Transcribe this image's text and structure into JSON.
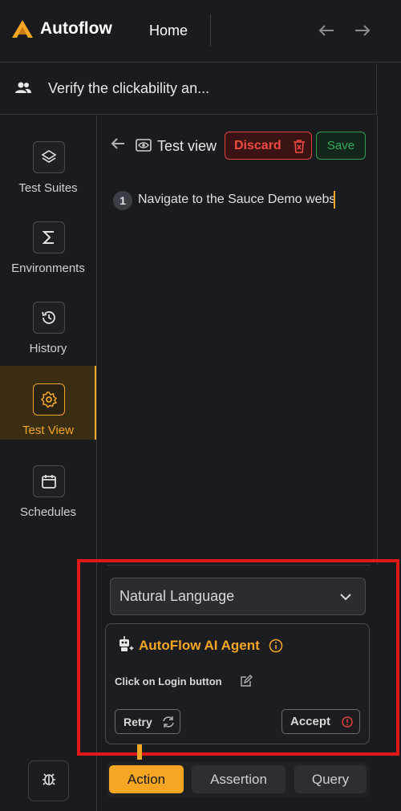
{
  "header": {
    "app_name": "Autoflow",
    "home_label": "Home",
    "back_icon": "arrow-left-icon",
    "forward_icon": "arrow-right-icon"
  },
  "task": {
    "icon": "users-icon",
    "title": "Verify the clickability an..."
  },
  "sidebar": {
    "items": [
      {
        "label": "Test Suites",
        "icon": "layers-icon",
        "active": false
      },
      {
        "label": "Environments",
        "icon": "sigma-icon",
        "active": false
      },
      {
        "label": "History",
        "icon": "history-icon",
        "active": false
      },
      {
        "label": "Test View",
        "icon": "gear-icon",
        "active": true
      },
      {
        "label": "Schedules",
        "icon": "calendar-icon",
        "active": false
      }
    ],
    "bug_icon": "bug-icon"
  },
  "main": {
    "title": "Test view",
    "discard_label": "Discard",
    "save_label": "Save",
    "steps": [
      {
        "number": "1",
        "text": "Navigate to the Sauce Demo webs"
      }
    ]
  },
  "panel": {
    "mode_select": "Natural Language",
    "agent_title": "AutoFlow AI Agent",
    "command": "Click on Login button",
    "retry_label": "Retry",
    "accept_label": "Accept",
    "tabs": [
      {
        "label": "Action",
        "active": true
      },
      {
        "label": "Assertion",
        "active": false
      },
      {
        "label": "Query",
        "active": false
      }
    ]
  },
  "colors": {
    "accent": "#f5a623",
    "danger": "#e0433a",
    "success": "#2f9e55",
    "background": "#1a1b1e",
    "highlight_frame": "#e01818"
  }
}
